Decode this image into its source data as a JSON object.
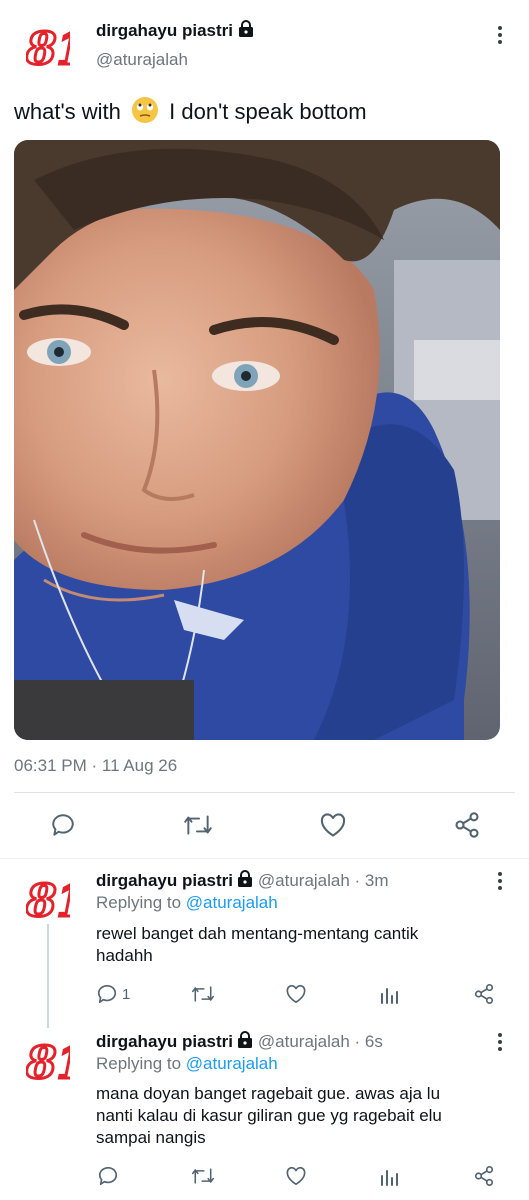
{
  "main_tweet": {
    "author_name": "dirgahayu piastri",
    "author_handle": "@aturajalah",
    "text_before_emoji": "what's with",
    "text_after_emoji": "I don't speak bottom",
    "timestamp": "06:31 PM · 11 Aug 26"
  },
  "replies": [
    {
      "author_name": "dirgahayu piastri",
      "author_handle": "@aturajalah · 3m",
      "replying_prefix": "Replying to",
      "replying_to": "@aturajalah",
      "text_line1": "rewel banget dah mentang-mentang cantik",
      "text_line2": "hadahh",
      "reply_count": "1"
    },
    {
      "author_name": "dirgahayu piastri",
      "author_handle": "@aturajalah · 6s",
      "replying_prefix": "Replying to",
      "replying_to": "@aturajalah",
      "text_line1": "mana doyan banget ragebait gue. awas aja lu",
      "text_line2": "nanti kalau di kasur giliran gue yg ragebait elu",
      "text_line3": "sampai nangis"
    }
  ],
  "colors": {
    "accent": "#1d9bf0",
    "logo_red": "#e3222b",
    "muted": "#6e767d"
  }
}
